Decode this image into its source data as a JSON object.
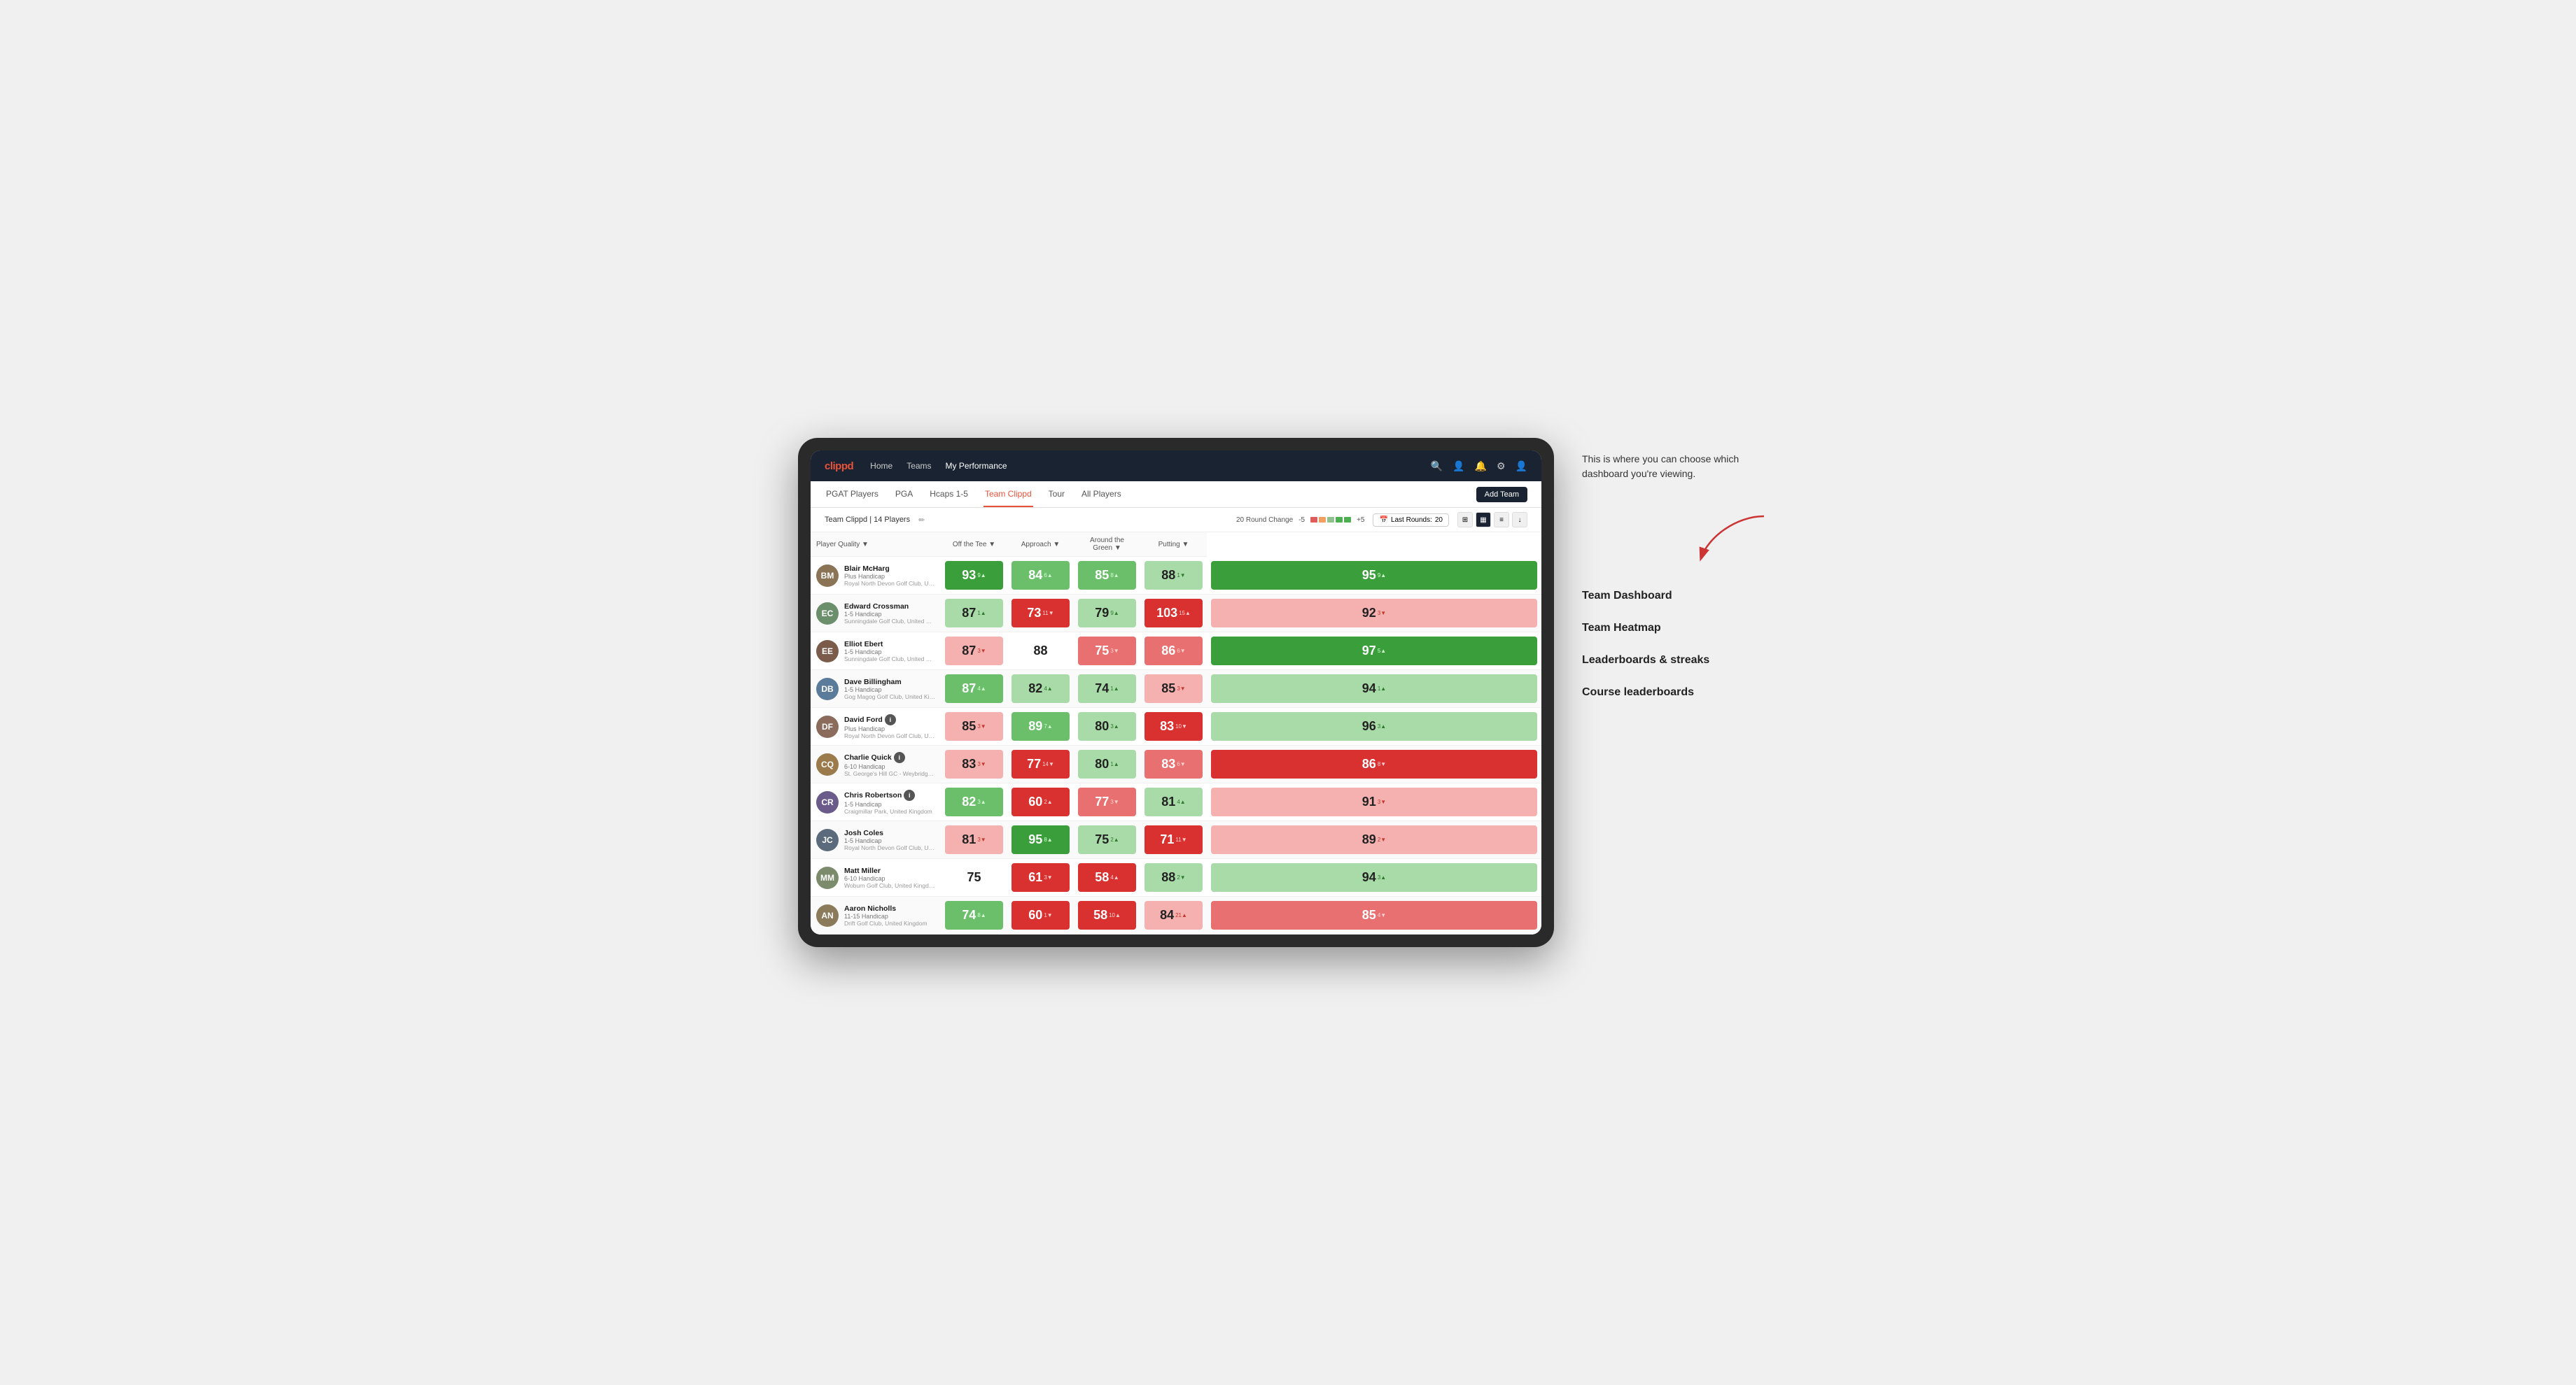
{
  "annotation": {
    "note": "This is where you can choose which dashboard you're viewing.",
    "items": [
      "Team Dashboard",
      "Team Heatmap",
      "Leaderboards & streaks",
      "Course leaderboards"
    ]
  },
  "nav": {
    "logo": "clippd",
    "links": [
      "Home",
      "Teams",
      "My Performance"
    ],
    "active_link": "My Performance"
  },
  "subnav": {
    "links": [
      "PGAT Players",
      "PGA",
      "Hcaps 1-5",
      "Team Clippd",
      "Tour",
      "All Players"
    ],
    "active_link": "Team Clippd",
    "add_team_label": "Add Team"
  },
  "team_header": {
    "title": "Team Clippd",
    "count": "14 Players",
    "round_change_label": "20 Round Change",
    "range_low": "-5",
    "range_high": "+5",
    "last_rounds_label": "Last Rounds:",
    "last_rounds_value": "20"
  },
  "columns": {
    "player": "Player Quality ▼",
    "metrics": [
      "Off the Tee ▼",
      "Approach ▼",
      "Around the Green ▼",
      "Putting ▼"
    ]
  },
  "players": [
    {
      "name": "Blair McHarg",
      "handicap": "Plus Handicap",
      "club": "Royal North Devon Golf Club, United Kingdom",
      "initials": "BM",
      "avatar_color": "#8B7355",
      "scores": [
        {
          "value": "93",
          "change": "9▲",
          "bg": "bg-green-strong"
        },
        {
          "value": "84",
          "change": "6▲",
          "bg": "bg-green-mid"
        },
        {
          "value": "85",
          "change": "8▲",
          "bg": "bg-green-mid"
        },
        {
          "value": "88",
          "change": "1▼",
          "bg": "bg-green-light"
        },
        {
          "value": "95",
          "change": "9▲",
          "bg": "bg-green-strong"
        }
      ]
    },
    {
      "name": "Edward Crossman",
      "handicap": "1-5 Handicap",
      "club": "Sunningdale Golf Club, United Kingdom",
      "initials": "EC",
      "avatar_color": "#6B8E6B",
      "scores": [
        {
          "value": "87",
          "change": "1▲",
          "bg": "bg-green-light"
        },
        {
          "value": "73",
          "change": "11▼",
          "bg": "bg-red-strong"
        },
        {
          "value": "79",
          "change": "9▲",
          "bg": "bg-green-light"
        },
        {
          "value": "103",
          "change": "15▲",
          "bg": "bg-red-strong"
        },
        {
          "value": "92",
          "change": "3▼",
          "bg": "bg-red-light"
        }
      ]
    },
    {
      "name": "Elliot Ebert",
      "handicap": "1-5 Handicap",
      "club": "Sunningdale Golf Club, United Kingdom",
      "initials": "EE",
      "avatar_color": "#7B5C4B",
      "scores": [
        {
          "value": "87",
          "change": "3▼",
          "bg": "bg-red-light"
        },
        {
          "value": "88",
          "change": "",
          "bg": "bg-white"
        },
        {
          "value": "75",
          "change": "3▼",
          "bg": "bg-red-mid"
        },
        {
          "value": "86",
          "change": "6▼",
          "bg": "bg-red-mid"
        },
        {
          "value": "97",
          "change": "5▲",
          "bg": "bg-green-strong"
        }
      ]
    },
    {
      "name": "Dave Billingham",
      "handicap": "1-5 Handicap",
      "club": "Gog Magog Golf Club, United Kingdom",
      "initials": "DB",
      "avatar_color": "#5B7B9B",
      "scores": [
        {
          "value": "87",
          "change": "4▲",
          "bg": "bg-green-mid"
        },
        {
          "value": "82",
          "change": "4▲",
          "bg": "bg-green-light"
        },
        {
          "value": "74",
          "change": "1▲",
          "bg": "bg-green-light"
        },
        {
          "value": "85",
          "change": "3▼",
          "bg": "bg-red-light"
        },
        {
          "value": "94",
          "change": "1▲",
          "bg": "bg-green-light"
        }
      ]
    },
    {
      "name": "David Ford",
      "handicap": "Plus Handicap",
      "club": "Royal North Devon Golf Club, United Kingdom",
      "initials": "DF",
      "avatar_color": "#8B6B5B",
      "has_info": true,
      "scores": [
        {
          "value": "85",
          "change": "3▼",
          "bg": "bg-red-light"
        },
        {
          "value": "89",
          "change": "7▲",
          "bg": "bg-green-mid"
        },
        {
          "value": "80",
          "change": "3▲",
          "bg": "bg-green-light"
        },
        {
          "value": "83",
          "change": "10▼",
          "bg": "bg-red-strong"
        },
        {
          "value": "96",
          "change": "3▲",
          "bg": "bg-green-light"
        }
      ]
    },
    {
      "name": "Charlie Quick",
      "handicap": "6-10 Handicap",
      "club": "St. George's Hill GC - Weybridge - Surrey, Uni...",
      "initials": "CQ",
      "avatar_color": "#9B7B4B",
      "has_info": true,
      "scores": [
        {
          "value": "83",
          "change": "3▼",
          "bg": "bg-red-light"
        },
        {
          "value": "77",
          "change": "14▼",
          "bg": "bg-red-strong"
        },
        {
          "value": "80",
          "change": "1▲",
          "bg": "bg-green-light"
        },
        {
          "value": "83",
          "change": "6▼",
          "bg": "bg-red-mid"
        },
        {
          "value": "86",
          "change": "8▼",
          "bg": "bg-red-strong"
        }
      ]
    },
    {
      "name": "Chris Robertson",
      "handicap": "1-5 Handicap",
      "club": "Craigmillar Park, United Kingdom",
      "initials": "CR",
      "avatar_color": "#6B5B8B",
      "has_info": true,
      "scores": [
        {
          "value": "82",
          "change": "3▲",
          "bg": "bg-green-mid"
        },
        {
          "value": "60",
          "change": "2▲",
          "bg": "bg-red-strong"
        },
        {
          "value": "77",
          "change": "3▼",
          "bg": "bg-red-mid"
        },
        {
          "value": "81",
          "change": "4▲",
          "bg": "bg-green-light"
        },
        {
          "value": "91",
          "change": "3▼",
          "bg": "bg-red-light"
        }
      ]
    },
    {
      "name": "Josh Coles",
      "handicap": "1-5 Handicap",
      "club": "Royal North Devon Golf Club, United Kingdom",
      "initials": "JC",
      "avatar_color": "#5B6B7B",
      "scores": [
        {
          "value": "81",
          "change": "3▼",
          "bg": "bg-red-light"
        },
        {
          "value": "95",
          "change": "8▲",
          "bg": "bg-green-strong"
        },
        {
          "value": "75",
          "change": "2▲",
          "bg": "bg-green-light"
        },
        {
          "value": "71",
          "change": "11▼",
          "bg": "bg-red-strong"
        },
        {
          "value": "89",
          "change": "2▼",
          "bg": "bg-red-light"
        }
      ]
    },
    {
      "name": "Matt Miller",
      "handicap": "6-10 Handicap",
      "club": "Woburn Golf Club, United Kingdom",
      "initials": "MM",
      "avatar_color": "#7B8B6B",
      "scores": [
        {
          "value": "75",
          "change": "",
          "bg": "bg-white"
        },
        {
          "value": "61",
          "change": "3▼",
          "bg": "bg-red-strong"
        },
        {
          "value": "58",
          "change": "4▲",
          "bg": "bg-red-strong"
        },
        {
          "value": "88",
          "change": "2▼",
          "bg": "bg-green-light"
        },
        {
          "value": "94",
          "change": "3▲",
          "bg": "bg-green-light"
        }
      ]
    },
    {
      "name": "Aaron Nicholls",
      "handicap": "11-15 Handicap",
      "club": "Drift Golf Club, United Kingdom",
      "initials": "AN",
      "avatar_color": "#8B7B5B",
      "scores": [
        {
          "value": "74",
          "change": "8▲",
          "bg": "bg-green-mid"
        },
        {
          "value": "60",
          "change": "1▼",
          "bg": "bg-red-strong"
        },
        {
          "value": "58",
          "change": "10▲",
          "bg": "bg-red-strong"
        },
        {
          "value": "84",
          "change": "21▲",
          "bg": "bg-red-light"
        },
        {
          "value": "85",
          "change": "4▼",
          "bg": "bg-red-mid"
        }
      ]
    }
  ]
}
